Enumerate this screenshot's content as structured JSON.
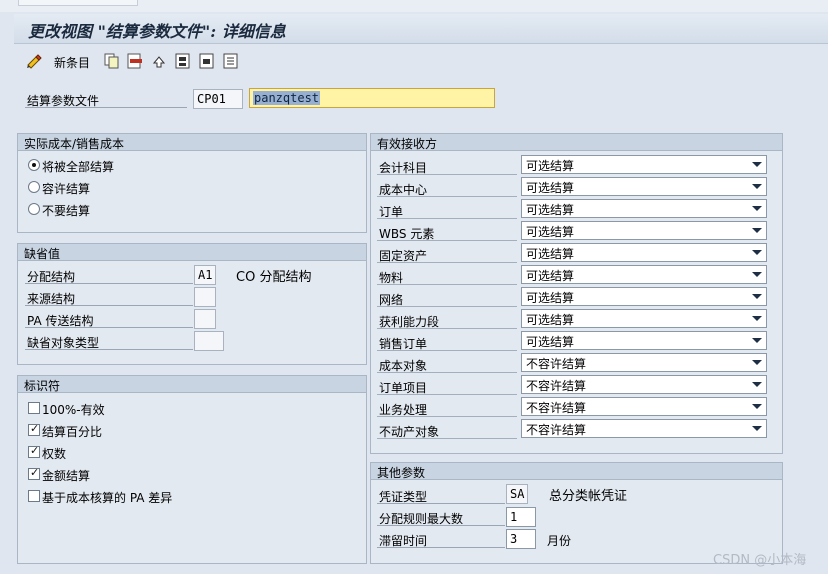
{
  "window": {
    "title": "更改视图 \"结算参数文件\": 详细信息"
  },
  "toolbar": {
    "new_entries_label": "新条目",
    "icons": [
      "glasses-icon",
      "copy-icon",
      "delete-icon",
      "undo-icon",
      "select-all-icon",
      "select-block-icon",
      "deselect-all-icon"
    ]
  },
  "profile": {
    "label": "结算参数文件",
    "code": "CP01",
    "text": "panzqtest"
  },
  "actual_costs": {
    "title": "实际成本/销售成本",
    "options": [
      "将被全部结算",
      "容许结算",
      "不要结算"
    ],
    "selected": 0
  },
  "defaults": {
    "title": "缺省值",
    "rows": [
      {
        "label": "分配结构",
        "value": "A1",
        "description": "CO 分配结构"
      },
      {
        "label": "来源结构",
        "value": ""
      },
      {
        "label": "PA 传送结构",
        "value": ""
      },
      {
        "label": "缺省对象类型",
        "value": ""
      }
    ]
  },
  "indicators": {
    "title": "标识符",
    "items": [
      {
        "label": "100%-有效",
        "checked": false
      },
      {
        "label": "结算百分比",
        "checked": true
      },
      {
        "label": "权数",
        "checked": true
      },
      {
        "label": "金额结算",
        "checked": true
      },
      {
        "label": "基于成本核算的 PA 差异",
        "checked": false
      }
    ]
  },
  "receivers": {
    "title": "有效接收方",
    "rows": [
      {
        "label": "会计科目",
        "value": "可选结算"
      },
      {
        "label": "成本中心",
        "value": "可选结算"
      },
      {
        "label": "订单",
        "value": "可选结算"
      },
      {
        "label": "WBS 元素",
        "value": "可选结算"
      },
      {
        "label": "固定资产",
        "value": "可选结算"
      },
      {
        "label": "物料",
        "value": "可选结算"
      },
      {
        "label": "网络",
        "value": "可选结算"
      },
      {
        "label": "获利能力段",
        "value": "可选结算"
      },
      {
        "label": "销售订单",
        "value": "可选结算"
      },
      {
        "label": "成本对象",
        "value": "不容许结算"
      },
      {
        "label": "订单项目",
        "value": "不容许结算"
      },
      {
        "label": "业务处理",
        "value": "不容许结算"
      },
      {
        "label": "不动产对象",
        "value": "不容许结算"
      }
    ]
  },
  "other": {
    "title": "其他参数",
    "document_type": {
      "label": "凭证类型",
      "value": "SA",
      "description": "总分类帐凭证"
    },
    "max_rules": {
      "label": "分配规则最大数",
      "value": "1"
    },
    "retention": {
      "label": "滞留时间",
      "value": "3",
      "unit": "月份"
    }
  },
  "watermark": "CSDN @小本海"
}
